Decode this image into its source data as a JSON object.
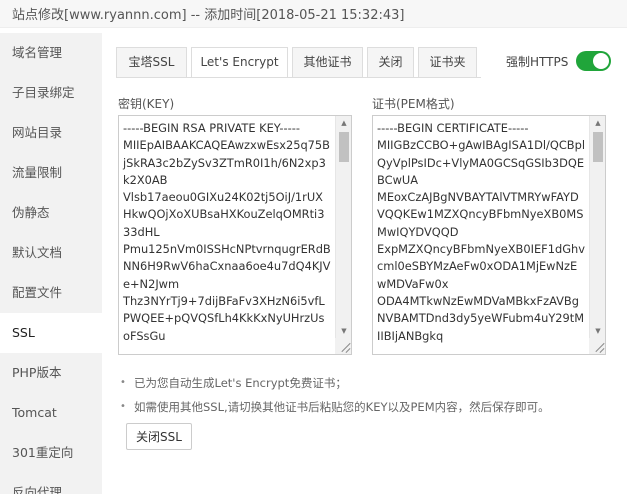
{
  "window": {
    "title": "站点修改[www.ryannn.com] -- 添加时间[2018-05-21 15:32:43]"
  },
  "sidebar": {
    "items": [
      {
        "label": "域名管理",
        "active": false
      },
      {
        "label": "子目录绑定",
        "active": false
      },
      {
        "label": "网站目录",
        "active": false
      },
      {
        "label": "流量限制",
        "active": false
      },
      {
        "label": "伪静态",
        "active": false
      },
      {
        "label": "默认文档",
        "active": false
      },
      {
        "label": "配置文件",
        "active": false
      },
      {
        "label": "SSL",
        "active": true
      },
      {
        "label": "PHP版本",
        "active": false
      },
      {
        "label": "Tomcat",
        "active": false
      },
      {
        "label": "301重定向",
        "active": false
      },
      {
        "label": "反向代理",
        "active": false
      }
    ]
  },
  "tabs": [
    {
      "label": "宝塔SSL",
      "active": false
    },
    {
      "label": "Let's Encrypt",
      "active": true
    },
    {
      "label": "其他证书",
      "active": false
    },
    {
      "label": "关闭",
      "active": false
    },
    {
      "label": "证书夹",
      "active": false
    }
  ],
  "force_https": {
    "label": "强制HTTPS",
    "enabled": true,
    "on_color": "#20a53a"
  },
  "key_field": {
    "label": "密钥(KEY)",
    "value": "-----BEGIN RSA PRIVATE KEY-----\nMIIEpAIBAAKCAQEAwzxwEsx25q75BjSkRA3c2bZySv3ZTmR0I1h/6N2xp3k2X0AB\nVlsb17aeou0GIXu24K02tj5OiJ/1rUXHkwQOjXoXUBsaHXKouZelqOMRti333dHL\nPmu125nVm0ISSHcNPtvrnqugrERdBNN6H9RwV6haCxnaa6oe4u7dQ4KJVe+N2Jwm\nThz3NYrTj9+7dijBFaFv3XHzN6i5vfLPWQEE+pQVQSfLh4KkKxNyUHrzUsoFSsGu"
  },
  "cert_field": {
    "label": "证书(PEM格式)",
    "value": "-----BEGIN CERTIFICATE-----\nMIIGBzCCBO+gAwIBAgISA1Dl/QCBplQyVplPsIDc+VlyMA0GCSqGSIb3DQEBCwUA\nMEoxCzAJBgNVBAYTAlVTMRYwFAYDVQQKEw1MZXQncyBFbmNyeXB0MSMwIQYDVQQD\nExpMZXQncyBFbmNyeXB0IEF1dGhvcml0eSBYMzAeFw0xODA1MjEwNzEwMDVaFw0x\nODA4MTkwNzEwMDVaMBkxFzAVBgNVBAMTDnd3dy5yeWFubm4uY29tMIIBIjANBgkq"
  },
  "notes": [
    "已为您自动生成Let's Encrypt免费证书；",
    "如需使用其他SSL,请切换其他证书后粘贴您的KEY以及PEM内容，然后保存即可。"
  ],
  "close_ssl_button": {
    "label": "关闭SSL"
  }
}
